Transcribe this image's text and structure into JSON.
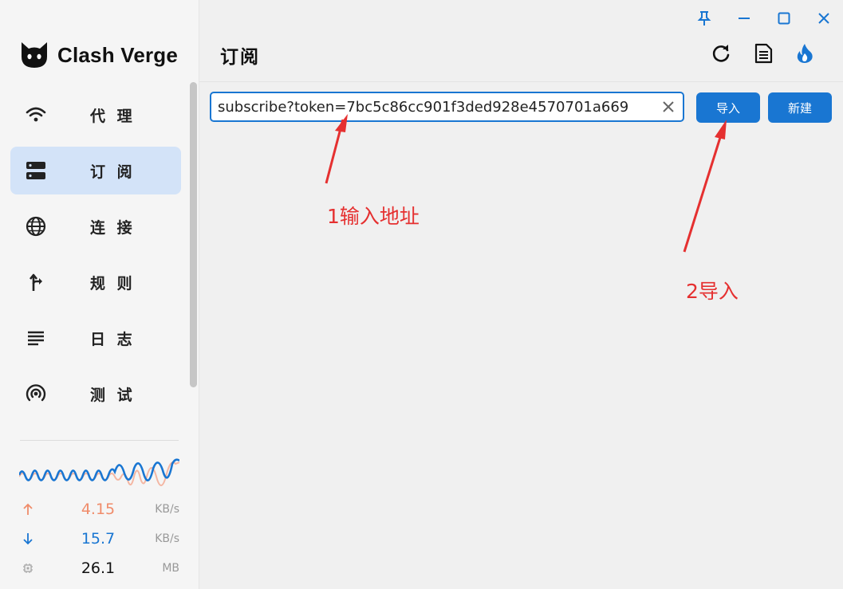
{
  "app": {
    "name": "Clash Verge",
    "page_title": "订阅"
  },
  "sidebar": {
    "items": [
      {
        "label": "代 理",
        "icon": "wifi-icon",
        "active": false
      },
      {
        "label": "订 阅",
        "icon": "server-icon",
        "active": true
      },
      {
        "label": "连 接",
        "icon": "globe-icon",
        "active": false
      },
      {
        "label": "规 则",
        "icon": "route-icon",
        "active": false
      },
      {
        "label": "日 志",
        "icon": "list-icon",
        "active": false
      },
      {
        "label": "测 试",
        "icon": "radar-icon",
        "active": false
      }
    ]
  },
  "traffic": {
    "upload": {
      "value": "4.15",
      "unit": "KB/s",
      "color": "#f08c6a"
    },
    "download": {
      "value": "15.7",
      "unit": "KB/s",
      "color": "#1976d2"
    },
    "memory": {
      "value": "26.1",
      "unit": "MB"
    }
  },
  "subscription": {
    "url_value": "subscribe?token=7bc5c86cc901f3ded928e4570701a669",
    "import_label": "导入",
    "new_label": "新建"
  },
  "annotations": {
    "step1": "1输入地址",
    "step2": "2导入",
    "color": "#e53030"
  },
  "colors": {
    "accent": "#1976d2",
    "active_bg": "#d3e3f8"
  }
}
